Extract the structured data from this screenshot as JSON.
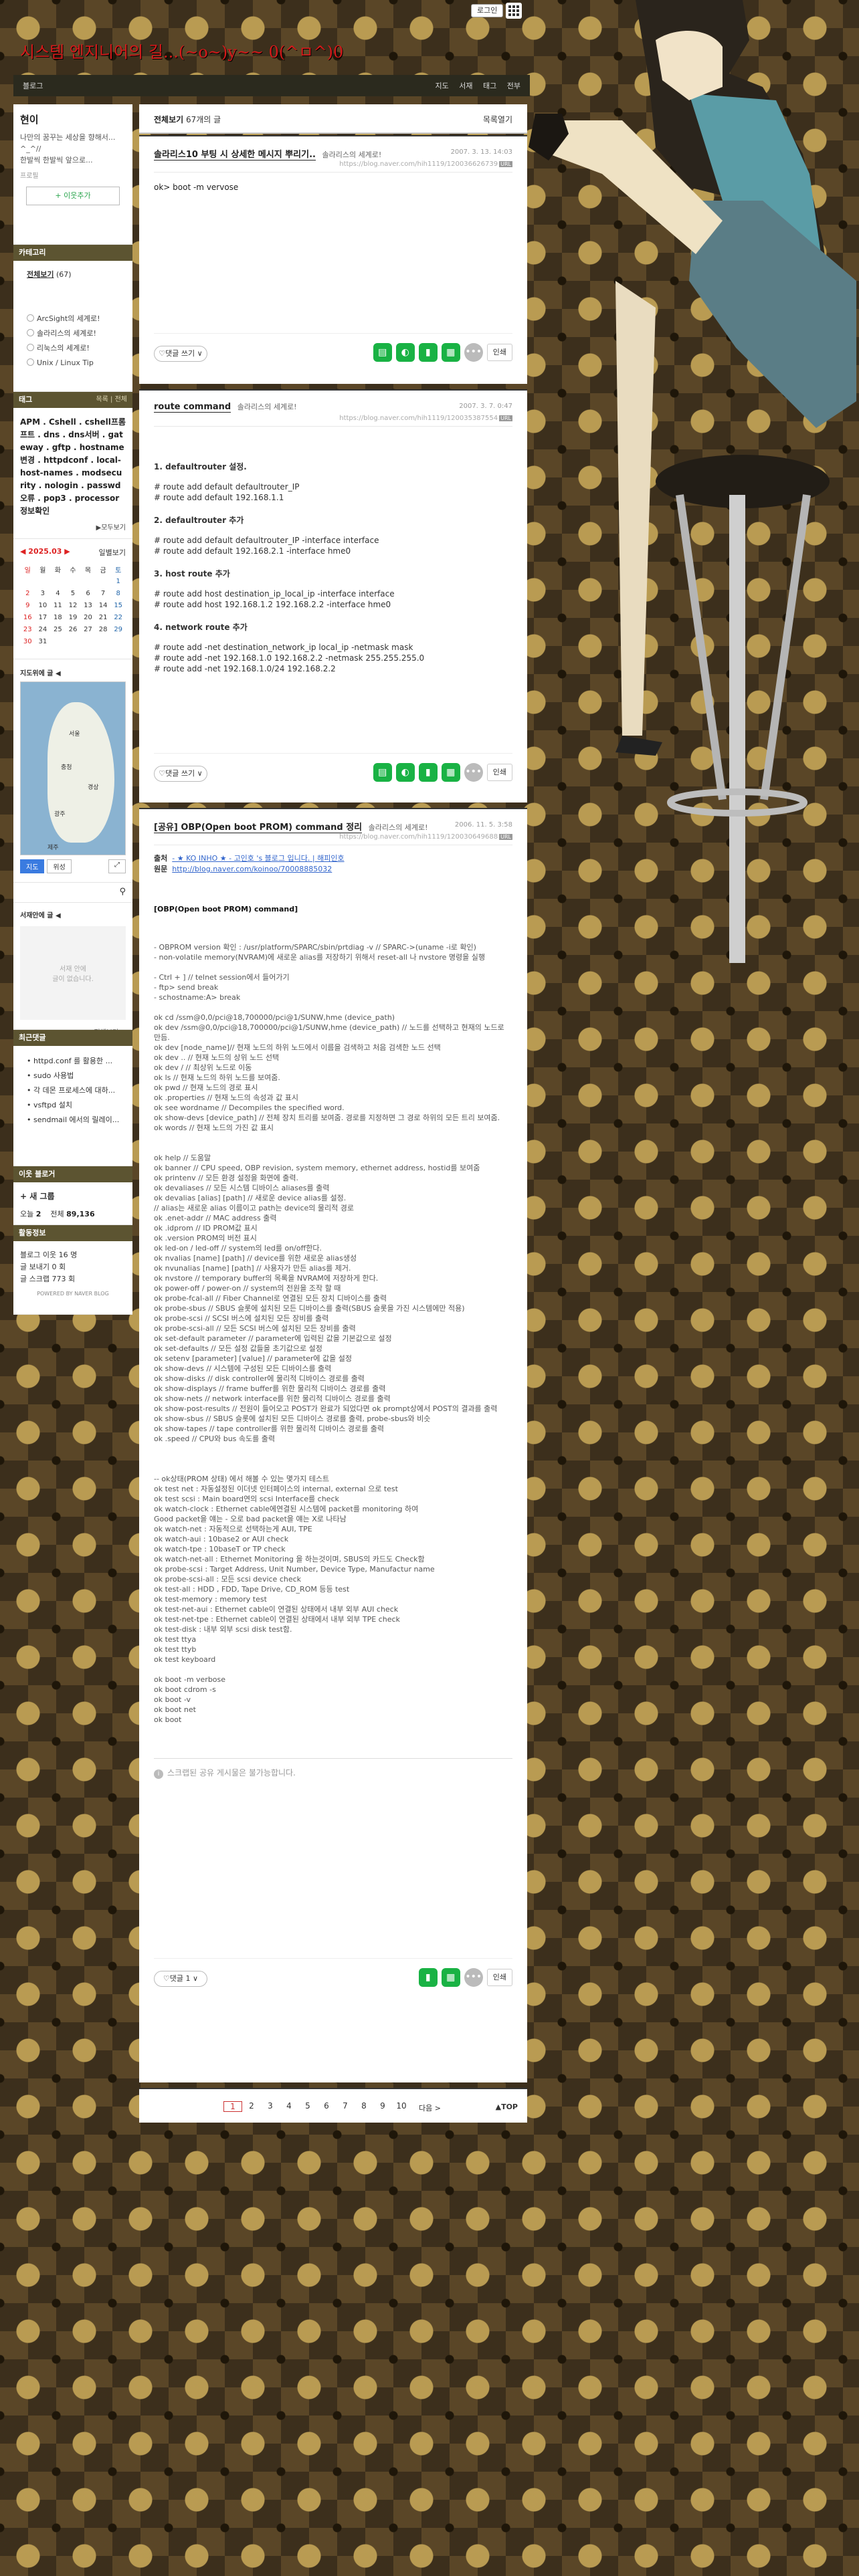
{
  "top": {
    "login": "로그인"
  },
  "blog": {
    "title": "시스템 엔지니어의 길...(~o~)y~~ 0(^ㅁ^)0"
  },
  "nav": {
    "home": "블로그",
    "links": [
      "지도",
      "서재",
      "태그",
      "전부"
    ]
  },
  "profile": {
    "nickname": "현이",
    "intro": "나만의 꿈꾸는 세상을 향해서... ^_^//\n한발씩 한발씩 앞으로...",
    "profile_link": "프로필",
    "add_neighbor": "+ 이웃추가"
  },
  "category": {
    "title": "카테고리",
    "all": "전체보기",
    "all_count": "(67)",
    "items": [
      "ArcSight의 세계로!",
      "솔라리스의 세계로!",
      "리눅스의 세계로!",
      "Unix / Linux Tip"
    ]
  },
  "tags": {
    "title": "태그",
    "tab_right": "목록 | 전체",
    "text": "APM . Cshell . cshell프롬프트 . dns . dns서버 . gateway . gftp . hostname변경 . httpdconf . local-host-names . modsecurity . nologin . passwd오류 . pop3 . processor정보확인",
    "more": "▶모두보기"
  },
  "calendar": {
    "month": "◀ 2025.03 ▶",
    "goto": "일별보기",
    "days": [
      "일",
      "월",
      "화",
      "수",
      "목",
      "금",
      "토"
    ],
    "weeks": [
      [
        "",
        "",
        "",
        "",
        "",
        "",
        "1"
      ],
      [
        "2",
        "3",
        "4",
        "5",
        "6",
        "7",
        "8"
      ],
      [
        "9",
        "10",
        "11",
        "12",
        "13",
        "14",
        "15"
      ],
      [
        "16",
        "17",
        "18",
        "19",
        "20",
        "21",
        "22"
      ],
      [
        "23",
        "24",
        "25",
        "26",
        "27",
        "28",
        "29"
      ],
      [
        "30",
        "31",
        "",
        "",
        "",
        "",
        ""
      ]
    ]
  },
  "map": {
    "title": "지도위에 글 ◀",
    "labels": [
      "서울",
      "충청",
      "경상",
      "광주",
      "제주"
    ],
    "btn_map": "지도",
    "btn_sat": "위성"
  },
  "widget": {
    "title": "서재안에 글 ◀",
    "empty": "서재 안에\n글이 없습니다.",
    "link": "전체보기 ▷"
  },
  "recent": {
    "title": "최근댓글",
    "items": [
      "httpd.conf 를 활용한 ...",
      "sudo 사용법",
      "각 데몬 프로세스에 대하...",
      "vsftpd 설치",
      "sendmail 에서의 릴레이..."
    ]
  },
  "neighbor": {
    "title": "이웃 블로거",
    "item": "새 그룹",
    "today_label": "오늘",
    "today": "2",
    "total_label": "전체",
    "total": "89,136"
  },
  "activity": {
    "title": "활동정보",
    "lines": [
      "블로그 이웃 16 명",
      "글 보내기 0 회",
      "글 스크랩 773 회"
    ],
    "powered": "POWERED BY NAVER BLOG"
  },
  "list": {
    "header": "전체보기",
    "count": "67개의 글",
    "open": "목록열기"
  },
  "posts": [
    {
      "title": "솔라리스10 부팅 시 상세한 메시지 뿌리기..",
      "category": "솔라리스의 세계로!",
      "date": "2007. 3. 13. 14:03",
      "url": "https://blog.naver.com/hih1119/120036626739",
      "body": "ok> boot -m vervose",
      "comment": "♡댓글 쓰기 ∨",
      "print": "인쇄"
    },
    {
      "title": "route command",
      "category": "솔라리스의 세계로!",
      "date": "2007. 3. 7. 0:47",
      "url": "https://blog.naver.com/hih1119/120035387554",
      "sections": [
        {
          "h": "1. defaultrouter 설정.",
          "lines": [
            "# route add default defaultrouter_IP",
            "# route add default 192.168.1.1"
          ]
        },
        {
          "h": "2. defaultrouter 추가",
          "lines": [
            "# route add default defaultrouter_IP -interface interface",
            "# route add default 192.168.2.1 -interface hme0"
          ]
        },
        {
          "h": "3. host route 추가",
          "lines": [
            "# route add host destination_ip_local_ip -interface interface",
            "# route add host 192.168.1.2 192.168.2.2 -interface hme0"
          ]
        },
        {
          "h": "4. network route 추가",
          "lines": [
            "# route add -net destination_network_ip local_ip -netmask mask",
            "# route add -net 192.168.1.0 192.168.2.2 -netmask 255.255.255.0",
            "# route add -net 192.168.1.0/24 192.168.2.2"
          ]
        }
      ],
      "comment": "♡댓글 쓰기 ∨",
      "print": "인쇄"
    },
    {
      "title": "[공유] OBP(Open boot PROM) command 정리",
      "category": "솔라리스의 세계로!",
      "date": "2006. 11. 5. 3:58",
      "url": "https://blog.naver.com/hih1119/120030649688",
      "source_label": "출처",
      "source": "- ★ KO INHO ★ - 고인호 's 블로그 입니다. | 해피인호",
      "orig_label": "원문",
      "orig": "http://blog.naver.com/koinoo/70008885032",
      "head": "[OBP(Open boot PROM) command]",
      "body": "- OBPROM version 확인 : /usr/platform/SPARC/sbin/prtdiag -v // SPARC->(uname -i로 확인)\n- non-volatile memory(NVRAM)에 새로운 alias를 저장하기 위해서 reset-all 나 nvstore 명령을 실행\n\n- Ctrl + ] // telnet session에서 들어가기\n- ftp> send break\n- schostname:A> break\n\nok cd /ssm@0,0/pci@18,700000/pci@1/SUNW,hme (device_path)\nok dev /ssm@0,0/pci@18,700000/pci@1/SUNW,hme (device_path) // 노드를 선택하고 현재의 노드로 만듬.\nok dev [node_name]// 현재 노드의 하위 노드에서 이름을 검색하고 처음 검색한 노드 선택\nok dev .. // 현재 노드의 상위 노드 선택\nok dev / // 최상위 노드로 이동\nok ls // 현재 노드의 하위 노드를 보여줌.\nok pwd // 현재 노드의 경로 표시\nok .properties // 현재 노드의 속성과 값 표시\nok see wordname // Decompiles the specified word.\nok show-devs [device_path] // 전체 장치 트리를 보여줌. 경로를 지정하면 그 경로 하위의 모든 트리 보여줌.\nok words // 현재 노드의 가진 값 표시\n\n\nok help // 도움말\nok banner // CPU speed, OBP revision, system memory, ethernet address, hostid를 보여줌\nok printenv // 모든 환경 설정을 화면에 출력.\nok devaliases // 모든 시스템 디바이스 aliases를 출력\nok devalias [alias] [path] // 새로운 device alias를 설정.\n// alias는 새로운 alias 이름이고 path는 device의 물리적 경로\nok .enet-addr // MAC address 출력\nok .idprom // ID PROM값 표시\nok .version PROM의 버전 표시\nok led-on / led-off // system의 led를 on/off한다.\nok nvalias [name] [path] // device를 위한 새로운 alias생성\nok nvunalias [name] [path] // 사용자가 만든 alias를 제거.\nok nvstore // temporary buffer의 목록을 NVRAM에 저장하게 한다.\nok power-off / power-on // system의 전원을 조작 할 때\nok probe-fcal-all // Fiber Channel로 연결된 모든 장치 디바이스를 출력\nok probe-sbus // SBUS 슬롯에 설치된 모든 디바이스를 출력(SBUS 슬롯을 가진 시스템에만 적용)\nok probe-scsi // SCSI 버스에 설치된 모든 장비를 출력\nok probe-scsi-all // 모든 SCSI 버스에 설치된 모든 장비를 출력\nok set-default parameter // parameter에 입력된 값을 기본값으로 설정\nok set-defaults // 모든 설정 값들을 초기값으로 설정\nok setenv [parameter] [value] // parameter에 값을 설정\nok show-devs // 시스템에 구성된 모든 디바이스를 출력\nok show-disks // disk controller에 물리적 디바이스 경로를 출력\nok show-displays // frame buffer를 위한 물리적 디바이스 경로를 출력\nok show-nets // network interface를 위한 물리적 디바이스 경로를 출력\nok show-post-results // 전원이 들어오고 POST가 완료가 되었다면 ok prompt상에서 POST의 결과를 출력\nok show-sbus // SBUS 슬롯에 설치된 모든 디바이스 경로를 출력, probe-sbus와 비슷\nok show-tapes // tape controller를 위한 물리적 디바이스 경로를 출력\nok .speed // CPU와 bus 속도를 출력\n\n\n\n-- ok상태(PROM 상태) 에서 해볼 수 있는 몇가지 테스트\nok test net : 자동설정된 이더넷 인터페이스의 internal, external 으로 test\nok test scsi : Main board연의 scsi Interface를 check\nok watch-clock : Ethernet cable에연결된 시스템에 packet를 monitoring 하여\nGood packet을 얘는 - 오로 bad packet을 얘는 X로 나타남\nok watch-net : 자동적으로 선택하는게 AUI, TPE\nok watch-aui : 10base2 or AUI check\nok watch-tpe : 10baseT or TP check\nok watch-net-all : Ethernet Monitoring 을 하는것이며, SBUS의 카드도 Check함\nok probe-scsi : Target Address, Unit Number, Device Type, Manufactur name\nok probe-scsi-all : 모든 scsi device check\nok test-all : HDD , FDD, Tape Drive, CD_ROM 등등 test\nok test-memory : memory test\nok test-net-aui : Ethernet cable이 연결된 상태에서 내부 외부 AUI check\nok test-net-tpe : Ethernet cable이 연결된 상태에서 내부 외부 TPE check\nok test-disk : 내부 외부 scsi disk test함.\nok test ttya\nok test ttyb\nok test keyboard\n\nok boot -m verbose\nok boot cdrom -s\nok boot -v\nok boot net\nok boot",
      "scrap_note": "스크랩된 공유 게시물은 불가능합니다.",
      "comment": "♡댓글 1 ∨",
      "print": "인쇄"
    }
  ],
  "pager": {
    "pages": [
      "1",
      "2",
      "3",
      "4",
      "5",
      "6",
      "7",
      "8",
      "9",
      "10"
    ],
    "current": "1",
    "next": "다음 >",
    "top": "▲TOP"
  }
}
